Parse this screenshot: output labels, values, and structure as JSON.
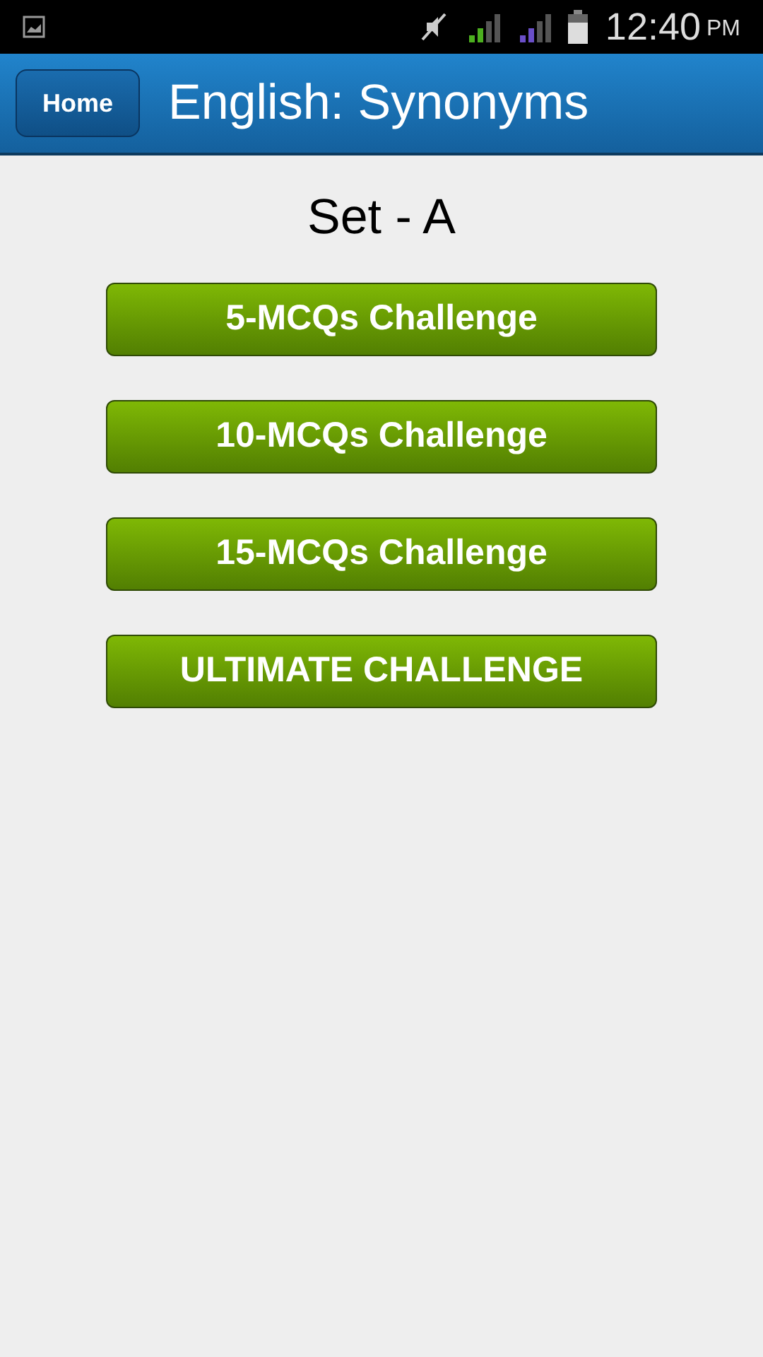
{
  "status_bar": {
    "time": "12:40",
    "ampm": "PM"
  },
  "header": {
    "home_button": "Home",
    "title": "English: Synonyms"
  },
  "set_title": "Set - A",
  "challenges": [
    "5-MCQs Challenge",
    "10-MCQs Challenge",
    "15-MCQs Challenge",
    "ULTIMATE CHALLENGE"
  ]
}
